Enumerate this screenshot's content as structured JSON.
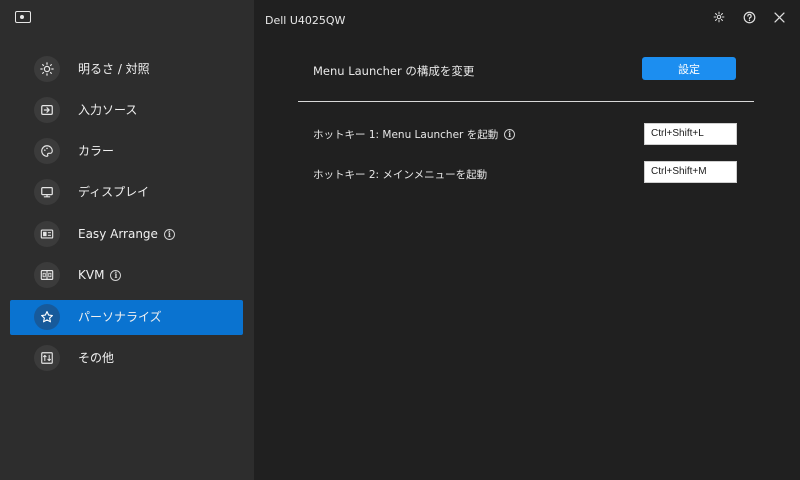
{
  "window": {
    "title": "Dell U4025QW"
  },
  "sidebar": {
    "items": [
      {
        "label": "明るさ / 対照",
        "icon": "brightness-icon",
        "info": false,
        "active": false
      },
      {
        "label": "入力ソース",
        "icon": "input-source-icon",
        "info": false,
        "active": false
      },
      {
        "label": "カラー",
        "icon": "palette-icon",
        "info": false,
        "active": false
      },
      {
        "label": "ディスプレイ",
        "icon": "monitor-icon",
        "info": false,
        "active": false
      },
      {
        "label": "Easy Arrange",
        "icon": "layout-icon",
        "info": true,
        "active": false
      },
      {
        "label": "KVM",
        "icon": "kvm-icon",
        "info": true,
        "active": false
      },
      {
        "label": "パーソナライズ",
        "icon": "star-icon",
        "info": false,
        "active": true
      },
      {
        "label": "その他",
        "icon": "misc-icon",
        "info": false,
        "active": false
      }
    ]
  },
  "main": {
    "section_heading": "Menu Launcher の構成を変更",
    "configure_button": "設定",
    "hotkeys": [
      {
        "label": "ホットキー 1: Menu Launcher を起動",
        "info": true,
        "value": "Ctrl+Shift+L"
      },
      {
        "label": "ホットキー 2: メインメニューを起動",
        "info": false,
        "value": "Ctrl+Shift+M"
      }
    ]
  },
  "colors": {
    "accent": "#0a73d0",
    "button": "#1c8ef0",
    "sidebar_bg": "#2d2d2d",
    "main_bg": "#202020"
  }
}
